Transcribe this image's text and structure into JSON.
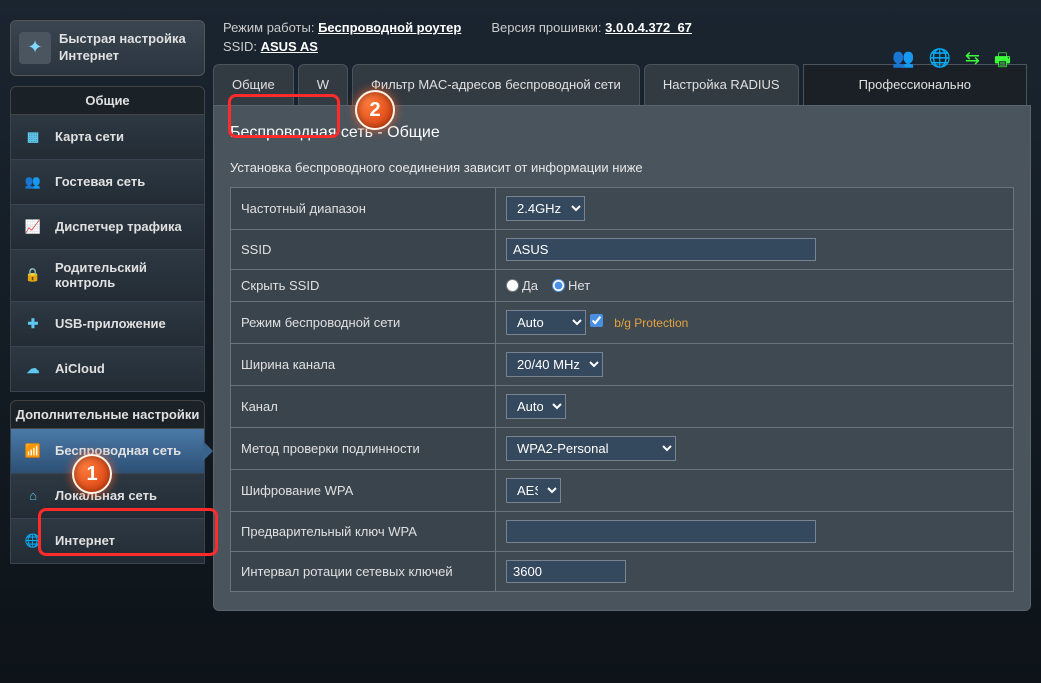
{
  "header": {
    "mode_label": "Режим работы:",
    "mode_value": "Беспроводной роутер",
    "fw_label": "Версия прошивки:",
    "fw_value": "3.0.0.4.372_67",
    "ssid_label": "SSID:",
    "ssid_values": "ASUS  AS"
  },
  "status_icons": [
    "persons-icon",
    "globe-icon",
    "usb-icon",
    "printer-icon"
  ],
  "quick_setup": {
    "line1": "Быстрая настройка",
    "line2": "Интернет"
  },
  "sidebar": {
    "general_header": "Общие",
    "general_items": [
      {
        "label": "Карта сети",
        "icon": "network-map-icon"
      },
      {
        "label": "Гостевая сеть",
        "icon": "guest-icon"
      },
      {
        "label": "Диспетчер трафика",
        "icon": "traffic-icon"
      },
      {
        "label": "Родительский контроль",
        "icon": "lock-icon"
      },
      {
        "label": "USB-приложение",
        "icon": "puzzle-icon"
      },
      {
        "label": "AiCloud",
        "icon": "cloud-icon"
      }
    ],
    "advanced_header": "Дополнительные настройки",
    "advanced_items": [
      {
        "label": "Беспроводная сеть",
        "icon": "wifi-icon",
        "active": true
      },
      {
        "label": "Локальная сеть",
        "icon": "home-icon"
      },
      {
        "label": "Интернет",
        "icon": "globe-icon"
      }
    ]
  },
  "tabs": {
    "general": "Общие",
    "wps": "W",
    "macfilter": "Фильтр MAC-адресов беспроводной сети",
    "radius": "Настройка RADIUS",
    "professional": "Профессионально"
  },
  "panel": {
    "title": "Беспроводная сеть - Общие",
    "desc": "Установка беспроводного соединения зависит от информации ниже"
  },
  "form": {
    "band_label": "Частотный диапазон",
    "band_value": "2.4GHz",
    "ssid_label": "SSID",
    "ssid_value": "ASUS",
    "hide_label": "Скрыть SSID",
    "hide_yes": "Да",
    "hide_no": "Нет",
    "mode_label": "Режим беспроводной сети",
    "mode_value": "Auto",
    "protection": "b/g Protection",
    "width_label": "Ширина канала",
    "width_value": "20/40 MHz",
    "channel_label": "Канал",
    "channel_value": "Auto",
    "auth_label": "Метод проверки подлинности",
    "auth_value": "WPA2-Personal",
    "enc_label": "Шифрование WPA",
    "enc_value": "AES",
    "psk_label": "Предварительный ключ WPA",
    "psk_value": "",
    "rotation_label": "Интервал ротации сетевых ключей",
    "rotation_value": "3600"
  },
  "annotations": {
    "badge1": "1",
    "badge2": "2"
  }
}
